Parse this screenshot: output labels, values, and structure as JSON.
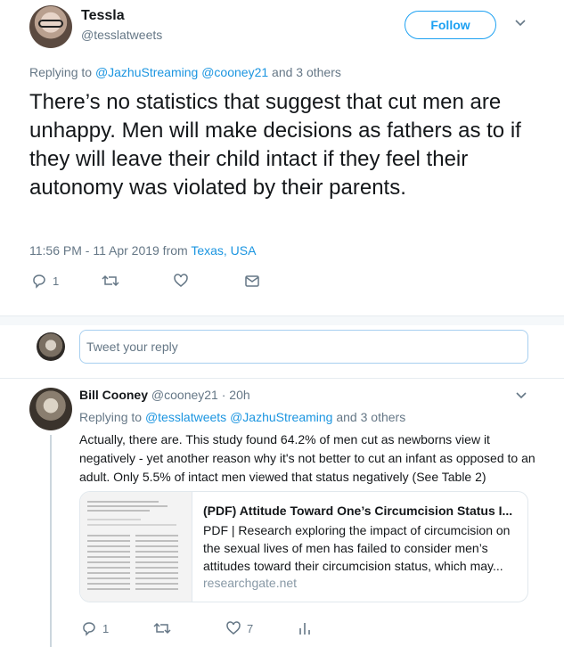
{
  "main_tweet": {
    "author_name": "Tessla",
    "author_handle": "@tesslatweets",
    "follow_label": "Follow",
    "replying_prefix": "Replying to",
    "replying_to": [
      "@JazhuStreaming",
      "@cooney21"
    ],
    "replying_suffix": "and 3 others",
    "text": "There’s no statistics that suggest that cut men are unhappy. Men will make decisions as fathers as to if they will leave their child intact if they feel their autonomy was violated by their parents.",
    "time": "11:56 PM - 11 Apr 2019 from",
    "location": "Texas, USA",
    "reply_count": "1",
    "retweet_count": "",
    "like_count": ""
  },
  "composer": {
    "placeholder": "Tweet your reply"
  },
  "reply_tweet": {
    "author_name": "Bill Cooney",
    "author_handle": "@cooney21",
    "age": "· 20h",
    "replying_prefix": "Replying to",
    "replying_to": [
      "@tesslatweets",
      "@JazhuStreaming"
    ],
    "replying_suffix": "and 3 others",
    "text": "Actually, there are. This study found 64.2% of men cut as newborns view it negatively - yet another reason why it's not better to cut an infant as opposed to an adult. Only 5.5% of intact men viewed that status negatively (See Table 2)",
    "card": {
      "title": "(PDF) Attitude Toward One’s Circumcision Status I...",
      "description": "PDF | Research exploring the impact of circumcision on the sexual lives of men has failed to consider men’s attitudes toward their circumcision status, which may...",
      "domain": "researchgate.net"
    },
    "reply_count": "1",
    "retweet_count": "",
    "like_count": "7"
  },
  "colors": {
    "accent": "#1da1f2",
    "link": "#1b95e0",
    "muted": "#657786",
    "divider": "#e6ecf0"
  }
}
